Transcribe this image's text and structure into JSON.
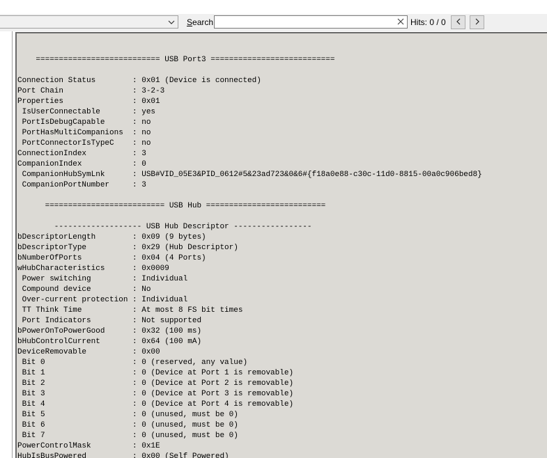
{
  "toolbar": {
    "combo_value": "",
    "search_label_prefix": "",
    "search_label_accel": "S",
    "search_label_rest": "earch:",
    "search_value": "",
    "search_placeholder": "",
    "hits_text": "Hits: 0 / 0",
    "prev_label": "<",
    "next_label": ">",
    "icons": {
      "combo_arrow": "chevron-down-icon",
      "clear": "close-icon"
    }
  },
  "report": {
    "lines": [
      "",
      "    =========================== USB Port3 ===========================",
      "",
      "Connection Status        : 0x01 (Device is connected)",
      "Port Chain               : 3-2-3",
      "Properties               : 0x01",
      " IsUserConnectable       : yes",
      " PortIsDebugCapable      : no",
      " PortHasMultiCompanions  : no",
      " PortConnectorIsTypeC    : no",
      "ConnectionIndex          : 3",
      "CompanionIndex           : 0",
      " CompanionHubSymLnk      : USB#VID_05E3&PID_0612#5&23ad723&0&6#{f18a0e88-c30c-11d0-8815-00a0c906bed8}",
      " CompanionPortNumber     : 3",
      "",
      "      ========================== USB Hub ==========================",
      "",
      "        ------------------- USB Hub Descriptor -----------------",
      "bDescriptorLength        : 0x09 (9 bytes)",
      "bDescriptorType          : 0x29 (Hub Descriptor)",
      "bNumberOfPorts           : 0x04 (4 Ports)",
      "wHubCharacteristics      : 0x0009",
      " Power switching         : Individual",
      " Compound device         : No",
      " Over-current protection : Individual",
      " TT Think Time           : At most 8 FS bit times",
      " Port Indicators         : Not supported",
      "bPowerOnToPowerGood      : 0x32 (100 ms)",
      "bHubControlCurrent       : 0x64 (100 mA)",
      "DeviceRemovable          : 0x00",
      " Bit 0                   : 0 (reserved, any value)",
      " Bit 1                   : 0 (Device at Port 1 is removable)",
      " Bit 2                   : 0 (Device at Port 2 is removable)",
      " Bit 3                   : 0 (Device at Port 3 is removable)",
      " Bit 4                   : 0 (Device at Port 4 is removable)",
      " Bit 5                   : 0 (unused, must be 0)",
      " Bit 6                   : 0 (unused, must be 0)",
      " Bit 7                   : 0 (unused, must be 0)",
      "PowerControlMask         : 0x1E",
      "HubIsBusPowered          : 0x00 (Self Powered)"
    ]
  }
}
